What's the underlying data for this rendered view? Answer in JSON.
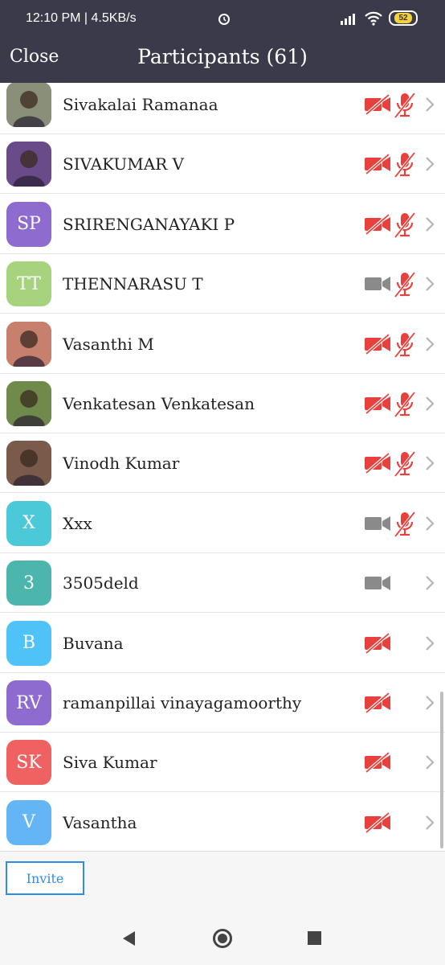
{
  "status_bar": {
    "time": "12:10 PM | 4.5KB/s",
    "battery": "52"
  },
  "header": {
    "close_label": "Close",
    "title": "Participants (61)"
  },
  "participants": [
    {
      "name": "Sivakalai Ramanaa",
      "initials": "",
      "avatar_type": "photo",
      "avatar_color": "#8a8f7a",
      "video": "off",
      "audio": "muted"
    },
    {
      "name": "SIVAKUMAR V",
      "initials": "",
      "avatar_type": "photo",
      "avatar_color": "#6a4b8a",
      "video": "off",
      "audio": "muted"
    },
    {
      "name": "SRIRENGANAYAKI P",
      "initials": "SP",
      "avatar_type": "initials",
      "avatar_color": "#8e6ccf",
      "video": "off",
      "audio": "muted"
    },
    {
      "name": "THENNARASU T",
      "initials": "TT",
      "avatar_type": "initials",
      "avatar_color": "#a7d37f",
      "video": "on",
      "audio": "muted"
    },
    {
      "name": "Vasanthi M",
      "initials": "",
      "avatar_type": "photo",
      "avatar_color": "#c7806e",
      "video": "off",
      "audio": "muted"
    },
    {
      "name": "Venkatesan Venkatesan",
      "initials": "",
      "avatar_type": "photo",
      "avatar_color": "#6f8a4a",
      "video": "off",
      "audio": "muted"
    },
    {
      "name": "Vinodh Kumar",
      "initials": "",
      "avatar_type": "photo",
      "avatar_color": "#7a5a4a",
      "video": "off",
      "audio": "muted"
    },
    {
      "name": "Xxx",
      "initials": "X",
      "avatar_type": "initials",
      "avatar_color": "#4cc9d9",
      "video": "on",
      "audio": "muted"
    },
    {
      "name": "3505deld",
      "initials": "3",
      "avatar_type": "initials",
      "avatar_color": "#4db6ac",
      "video": "on",
      "audio": "none"
    },
    {
      "name": "Buvana",
      "initials": "B",
      "avatar_type": "initials",
      "avatar_color": "#4fc3f7",
      "video": "off",
      "audio": "none"
    },
    {
      "name": "ramanpillai vinayagamoorthy",
      "initials": "RV",
      "avatar_type": "initials",
      "avatar_color": "#8e6ccf",
      "video": "off",
      "audio": "none"
    },
    {
      "name": "Siva Kumar",
      "initials": "SK",
      "avatar_type": "initials",
      "avatar_color": "#f06262",
      "video": "off",
      "audio": "none"
    },
    {
      "name": "Vasantha",
      "initials": "V",
      "avatar_type": "initials",
      "avatar_color": "#64b5f6",
      "video": "off",
      "audio": "none"
    }
  ],
  "footer": {
    "invite_label": "Invite"
  },
  "colors": {
    "header_bg": "#3b3a4a",
    "muted_red": "#e8403c",
    "video_on_gray": "#8a8a8a",
    "invite_blue": "#2d8cf0"
  }
}
